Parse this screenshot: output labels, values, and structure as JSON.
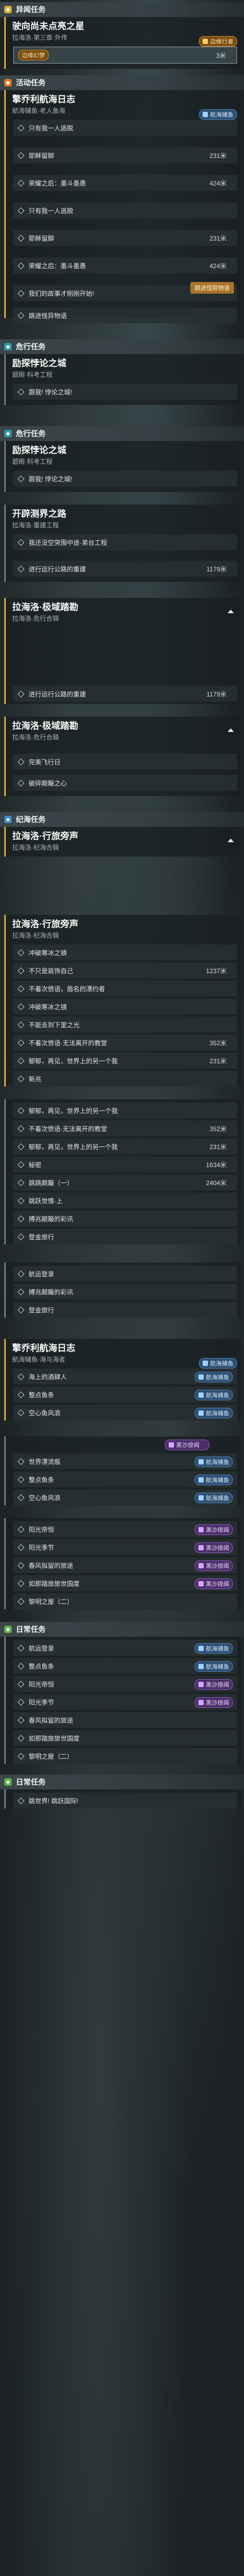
{
  "sections": {
    "s1": {
      "title": "异闻任务",
      "color": "#d9ab3a"
    },
    "s2": {
      "title": "活动任务",
      "color": "#e07828"
    },
    "s3": {
      "title": "危行任务",
      "color": "#2f9aa6"
    },
    "s4": {
      "title": "危行任务",
      "color": "#2f9aa6"
    },
    "s5": {
      "title": "纪海任务",
      "color": "#3a88c8"
    },
    "s6": {
      "title": "日常任务",
      "color": "#5fb04a"
    },
    "s7": {
      "title": "日常任务",
      "color": "#5fb04a"
    }
  },
  "q1": {
    "title": "驶向尚未点亮之星",
    "sub": "拉海洛·第三章·外传",
    "badge": "边缘行者",
    "row_label": "边缘幻梦",
    "row_dist": "3米"
  },
  "q2": {
    "title": "擎乔利航海日志",
    "sub": "航海辅鱼·老人鱼海",
    "badge": "航海捕鱼",
    "steps": [
      {
        "t": "只有我一人逃脱",
        "d": ""
      },
      {
        "t": "耶稣留脚",
        "d": "231米"
      },
      {
        "t": "荣耀之后：墨斗墨愚",
        "d": "424米"
      },
      {
        "t": "只有我一人逃脱",
        "d": ""
      },
      {
        "t": "耶稣留脚",
        "d": "231米"
      },
      {
        "t": "荣耀之后：墨斗墨愚",
        "d": "424米"
      },
      {
        "t": "我们的故事才刚刚开始!",
        "d": ""
      },
      {
        "t": "跳进怪异物语",
        "d": ""
      }
    ],
    "sticker": "跳进怪异物语"
  },
  "q3": {
    "title": "励探悖论之城",
    "sub": "题眼·科考工程",
    "steps": [
      {
        "t": "跟我! 悖论之城!",
        "d": ""
      }
    ]
  },
  "q4": {
    "title": "励探悖论之城",
    "sub": "题眼·科考工程",
    "steps": [
      {
        "t": "跟我! 悖论之城!",
        "d": ""
      }
    ]
  },
  "q5": {
    "title": "开辟测界之路",
    "sub": "拉海洛·重建工程",
    "steps": [
      {
        "t": "我还没空突围中途·弟台工程",
        "d": ""
      },
      {
        "t": "进行远行公路的重建",
        "d": "1179米"
      }
    ]
  },
  "q6": {
    "title": "拉海洛·极域踏勘",
    "sub": "拉海洛·危行合辑",
    "steps": [
      {
        "t": "进行远行公路的重建",
        "d": "1179米"
      }
    ]
  },
  "q7": {
    "title": "拉海洛·极域踏勘",
    "sub": "拉海洛·危行合辑",
    "steps": [
      {
        "t": "完美飞行日",
        "d": ""
      },
      {
        "t": "破碎颠簸之心",
        "d": ""
      }
    ]
  },
  "q8": {
    "title": "拉海洛·行旅旁声",
    "sub": "拉海洛·纪海合辑",
    "steps": []
  },
  "q9": {
    "title": "拉海洛·行旅旁声",
    "sub": "拉海洛·纪海合辑",
    "steps": [
      {
        "t": "冲破寒冰之镜",
        "d": ""
      },
      {
        "t": "不只是装饰自己",
        "d": "1237米"
      },
      {
        "t": "不着次愤语，眉名的漂约者",
        "d": ""
      },
      {
        "t": "冲破寒冰之镜",
        "d": ""
      },
      {
        "t": "不能去到下里之光",
        "d": ""
      },
      {
        "t": "不着次愤语·无法离开的教堂",
        "d": "352米"
      },
      {
        "t": "郁郁，再见，世界上的另一个我",
        "d": "231米"
      },
      {
        "t": "新兆",
        "d": ""
      }
    ]
  },
  "q10": {
    "steps": [
      {
        "t": "郁郁，再见，世界上的另一个我",
        "d": ""
      },
      {
        "t": "不着次愤语·无法离开的教堂",
        "d": "352米"
      },
      {
        "t": "郁郁，再见，世界上的另一个我",
        "d": "231米"
      },
      {
        "t": "秘密",
        "d": "1634米"
      },
      {
        "t": "跳跳颠簸（一）",
        "d": "2404米"
      },
      {
        "t": "跳跃世情·上",
        "d": ""
      },
      {
        "t": "搏兆颠簸的彩讯",
        "d": ""
      },
      {
        "t": "登金旅行",
        "d": ""
      }
    ]
  },
  "q11": {
    "steps": [
      {
        "t": "航运登录",
        "d": ""
      },
      {
        "t": "搏兆颠簸的彩讯",
        "d": ""
      },
      {
        "t": "登金旅行",
        "d": ""
      }
    ]
  },
  "q12": {
    "title": "擎乔利航海日志",
    "sub": "航海辅鱼·海与海者",
    "badge": "航海捕鱼",
    "steps": [
      {
        "t": "海上的酒肆人",
        "d": "",
        "b": "航海捕鱼"
      },
      {
        "t": "整点鱼条",
        "d": "",
        "b": "航海捕鱼"
      },
      {
        "t": "空心鱼风浪",
        "d": "",
        "b": "航海捕鱼"
      }
    ]
  },
  "q13": {
    "badge": "黑沙掠闻",
    "steps": [
      {
        "t": "世界漂流瓶",
        "d": "",
        "b": "航海捕鱼"
      },
      {
        "t": "整点鱼条",
        "d": "",
        "b": "航海捕鱼"
      },
      {
        "t": "空心鱼风浪",
        "d": "",
        "b": "航海捕鱼"
      }
    ]
  },
  "q14": {
    "steps": [
      {
        "t": "阳光帝恒",
        "d": "",
        "b": "黑沙掠闻"
      },
      {
        "t": "阳光季节",
        "d": "266米",
        "b": "黑沙掠闻"
      },
      {
        "t": "春风拟留的旅途",
        "d": "",
        "b": "黑沙掠闻"
      },
      {
        "t": "如那踏旅旅世国度",
        "d": "",
        "b": "黑沙掠闻"
      },
      {
        "t": "黎明之屋（二）",
        "d": ""
      }
    ]
  },
  "q15": {
    "steps": [
      {
        "t": "航运登录",
        "d": "",
        "b": "航海捕鱼"
      },
      {
        "t": "整点鱼条",
        "d": "",
        "b": "航海捕鱼"
      },
      {
        "t": "阳光帝恒",
        "d": "",
        "b": "黑沙掠闻"
      },
      {
        "t": "阳光季节",
        "d": "266米",
        "b": "黑沙掠闻"
      },
      {
        "t": "春风拟留的旅途",
        "d": ""
      },
      {
        "t": "如那踏旅旅世国度",
        "d": ""
      },
      {
        "t": "黎明之屋（二）",
        "d": ""
      }
    ]
  },
  "q16": {
    "steps": [
      {
        "t": "跳世界! 跳跃国际!",
        "d": ""
      }
    ]
  }
}
